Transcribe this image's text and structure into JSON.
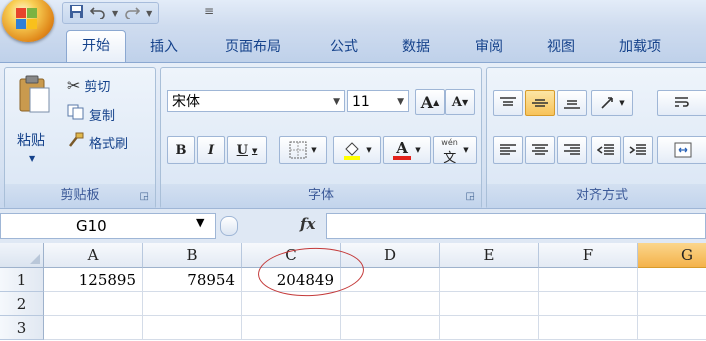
{
  "quick_access": {
    "save_icon": "save-icon",
    "undo_icon": "undo-icon",
    "redo_icon": "redo-icon",
    "customize": "≡"
  },
  "tabs": [
    "开始",
    "插入",
    "页面布局",
    "公式",
    "数据",
    "审阅",
    "视图",
    "加载项"
  ],
  "active_tab": "开始",
  "clipboard": {
    "paste_label": "粘贴",
    "cut_label": "剪切",
    "copy_label": "复制",
    "format_painter_label": "格式刷",
    "group_label": "剪贴板"
  },
  "font": {
    "name": "宋体",
    "size": "11",
    "grow_label": "A",
    "shrink_label": "A",
    "bold": "B",
    "italic": "I",
    "underline": "U",
    "color_letter": "A",
    "phonetic_top": "wén",
    "phonetic_bottom": "文",
    "group_label": "字体"
  },
  "alignment": {
    "group_label": "对齐方式"
  },
  "formula_bar": {
    "name_box": "G10",
    "fx_label": "fx"
  },
  "sheet": {
    "columns": [
      "A",
      "B",
      "C",
      "D",
      "E",
      "F",
      "G"
    ],
    "selected_column": "G",
    "rows": [
      {
        "num": "1",
        "cells": [
          "125895",
          "78954",
          "204849",
          "",
          "",
          "",
          ""
        ]
      },
      {
        "num": "2",
        "cells": [
          "",
          "",
          "",
          "",
          "",
          "",
          ""
        ]
      },
      {
        "num": "3",
        "cells": [
          "",
          "",
          "",
          "",
          "",
          "",
          ""
        ]
      }
    ]
  },
  "colors": {
    "accent": "#15428b",
    "selected_header": "#f4b24a",
    "annotation_circle": "#c43a3a"
  }
}
